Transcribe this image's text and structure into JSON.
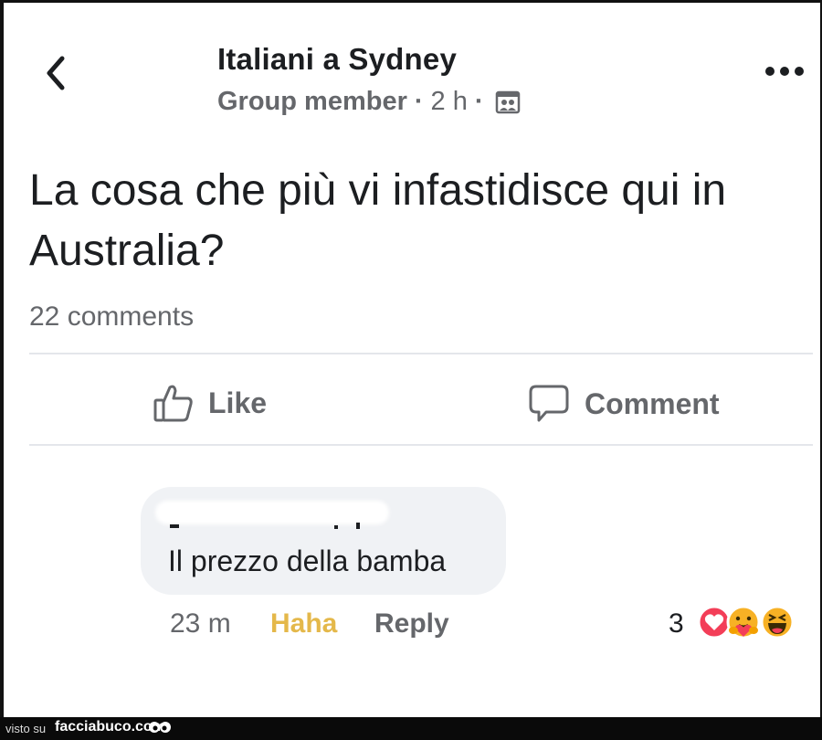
{
  "header": {
    "group_name": "Italiani a Sydney",
    "role": "Group member",
    "time": "2 h",
    "separator": "·"
  },
  "post": {
    "text": "La cosa che più vi infastidisce qui in Australia?",
    "comments_count": "22 comments"
  },
  "actions": {
    "like_label": "Like",
    "comment_label": "Comment"
  },
  "comment": {
    "text": "Il prezzo della bamba",
    "time": "23 m",
    "reaction_label": "Haha",
    "reply_label": "Reply",
    "reaction_count": "3",
    "reaction_icons": [
      "love-icon",
      "care-icon",
      "haha-icon"
    ]
  },
  "footer": {
    "prefix": "visto su",
    "site": "facciabuco.com"
  },
  "icons": {
    "back": "chevron-left-icon",
    "more": "more-dots-icon",
    "audience": "group-audience-icon",
    "like": "thumbs-up-icon",
    "comment": "speech-bubble-icon"
  },
  "colors": {
    "text_primary": "#1c1e21",
    "text_secondary": "#65676b",
    "haha_active": "#e4b84a",
    "bubble_bg": "#f0f2f5",
    "divider": "#e4e6eb",
    "love_red": "#f33e58",
    "reaction_yellow": "#f7b125",
    "footer_bg": "#0a0a0a"
  }
}
